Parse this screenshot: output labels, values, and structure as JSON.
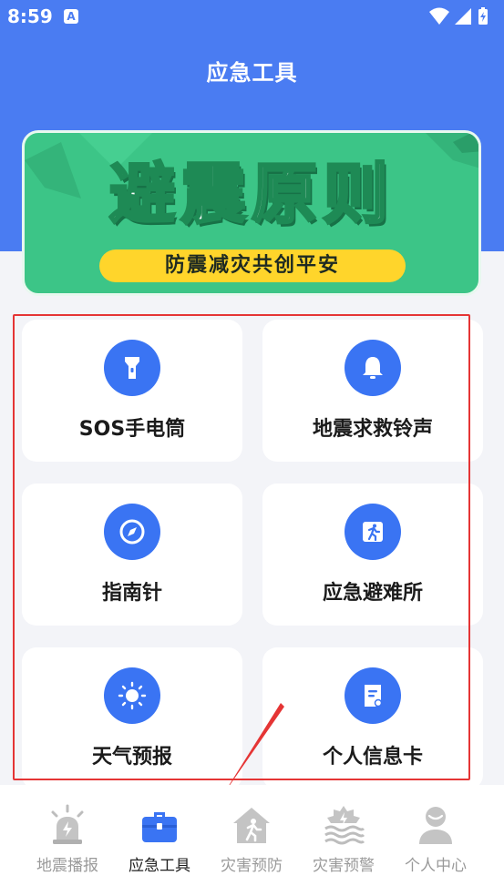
{
  "status_bar": {
    "time": "8:59",
    "notification_glyph": "A"
  },
  "header": {
    "title": "应急工具"
  },
  "banner": {
    "title": "避震原则",
    "subtitle": "防震减灾共创平安"
  },
  "tools": [
    {
      "label": "SOS手电筒",
      "icon": "flashlight-icon"
    },
    {
      "label": "地震求救铃声",
      "icon": "bell-icon"
    },
    {
      "label": "指南针",
      "icon": "compass-icon"
    },
    {
      "label": "应急避难所",
      "icon": "running-exit-icon"
    },
    {
      "label": "天气预报",
      "icon": "sun-icon"
    },
    {
      "label": "个人信息卡",
      "icon": "document-card-icon"
    }
  ],
  "bottom_nav": [
    {
      "label": "地震播报",
      "icon": "alarm-light-icon",
      "active": false
    },
    {
      "label": "应急工具",
      "icon": "toolbox-icon",
      "active": true
    },
    {
      "label": "灾害预防",
      "icon": "house-person-icon",
      "active": false
    },
    {
      "label": "灾害预警",
      "icon": "warning-wave-icon",
      "active": false
    },
    {
      "label": "个人中心",
      "icon": "user-icon",
      "active": false
    }
  ],
  "colors": {
    "primary": "#4a7cf2",
    "icon_blue": "#3a74f3",
    "banner_green": "#3cc587",
    "banner_pill": "#ffd52b",
    "highlight_red": "#e53535"
  }
}
